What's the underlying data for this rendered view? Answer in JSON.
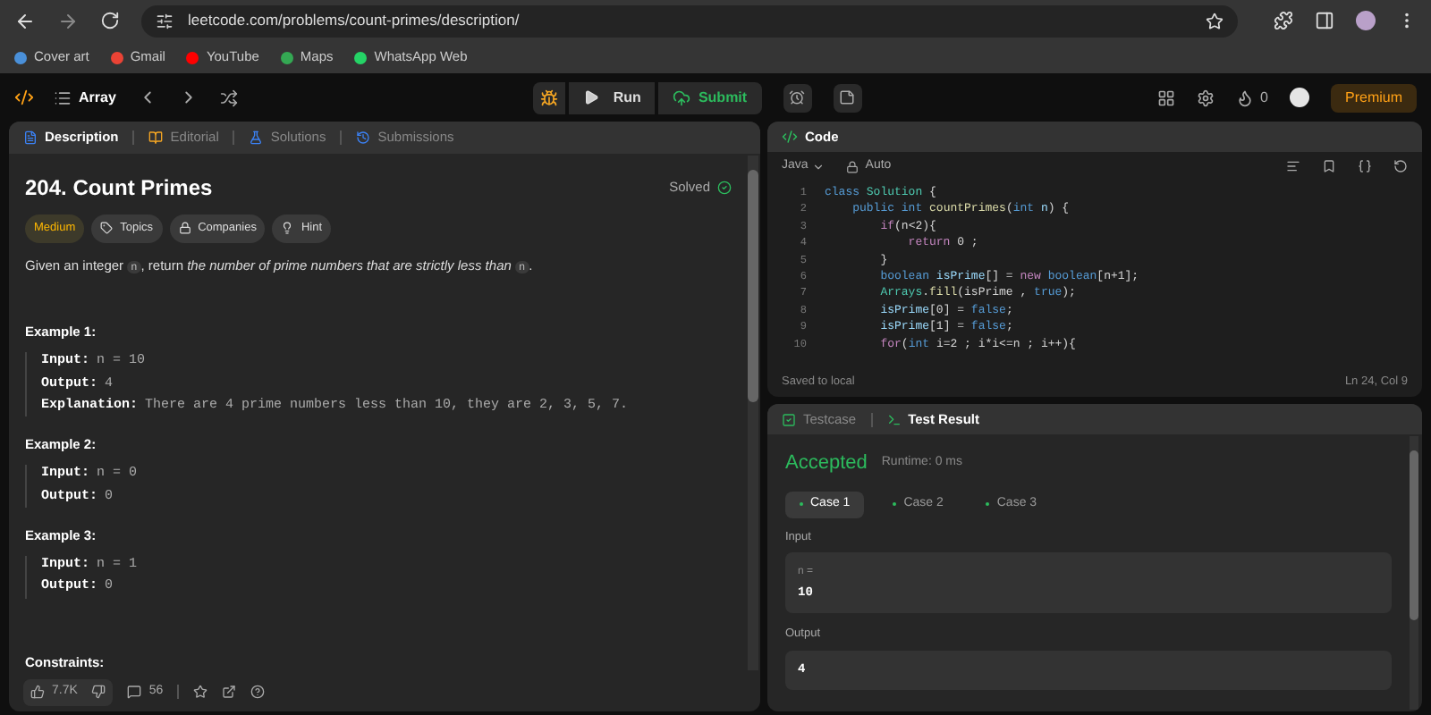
{
  "browser": {
    "url": "leetcode.com/problems/count-primes/description/",
    "bookmarks": [
      {
        "label": "Cover art",
        "color": "#4a90d9"
      },
      {
        "label": "Gmail",
        "color": "#ea4335"
      },
      {
        "label": "YouTube",
        "color": "#ff0000"
      },
      {
        "label": "Maps",
        "color": "#34a853"
      },
      {
        "label": "WhatsApp Web",
        "color": "#25d366"
      }
    ]
  },
  "nav": {
    "list_title": "Array",
    "run": "Run",
    "submit": "Submit",
    "streak": "0",
    "premium": "Premium"
  },
  "problem_tabs": [
    {
      "label": "Description",
      "selected": true
    },
    {
      "label": "Editorial",
      "selected": false
    },
    {
      "label": "Solutions",
      "selected": false
    },
    {
      "label": "Submissions",
      "selected": false
    }
  ],
  "problem": {
    "title": "204. Count Primes",
    "status": "Solved",
    "difficulty": "Medium",
    "tags": [
      "Topics",
      "Companies",
      "Hint"
    ],
    "description": [
      {
        "text": "Given an integer ",
        "kind": "plain"
      },
      {
        "text": "n",
        "kind": "code"
      },
      {
        "text": ", return ",
        "kind": "plain"
      },
      {
        "text": "the number of prime numbers that are strictly less than ",
        "kind": "italic"
      },
      {
        "text": "n",
        "kind": "code"
      },
      {
        "text": ".",
        "kind": "plain"
      }
    ],
    "examples": [
      {
        "title": "Example 1:",
        "lines": [
          {
            "label": "Input:",
            "value": "n = 10"
          },
          {
            "label": "Output:",
            "value": "4"
          },
          {
            "label": "Explanation:",
            "value": "There are 4 prime numbers less than 10, they are 2, 3, 5, 7."
          }
        ]
      },
      {
        "title": "Example 2:",
        "lines": [
          {
            "label": "Input:",
            "value": "n = 0"
          },
          {
            "label": "Output:",
            "value": "0"
          }
        ]
      },
      {
        "title": "Example 3:",
        "lines": [
          {
            "label": "Input:",
            "value": "n = 1"
          },
          {
            "label": "Output:",
            "value": "0"
          }
        ]
      }
    ],
    "constraints_title": "Constraints:"
  },
  "footer": {
    "likes": "7.7K",
    "comments": "56"
  },
  "code_panel": {
    "title": "Code",
    "language": "Java",
    "mode": "Auto",
    "status": "Saved to local",
    "cursor": "Ln 24, Col 9",
    "lines": [
      {
        "number": "1",
        "tokens": [
          {
            "text": "class ",
            "kind": "kw"
          },
          {
            "text": "Solution",
            "kind": "type"
          },
          {
            "text": " {",
            "kind": "p"
          }
        ]
      },
      {
        "number": "2",
        "tokens": [
          {
            "text": "    public int ",
            "kind": "kw"
          },
          {
            "text": "countPrimes",
            "kind": "fn"
          },
          {
            "text": "(",
            "kind": "p"
          },
          {
            "text": "int ",
            "kind": "kw"
          },
          {
            "text": "n",
            "kind": "var"
          },
          {
            "text": ") {",
            "kind": "p"
          }
        ]
      },
      {
        "number": "3",
        "tokens": [
          {
            "text": "        if",
            "kind": "ctl"
          },
          {
            "text": "(n<2){",
            "kind": "p"
          }
        ]
      },
      {
        "number": "4",
        "tokens": [
          {
            "text": "            return ",
            "kind": "ctl"
          },
          {
            "text": "0 ;",
            "kind": "p"
          }
        ]
      },
      {
        "number": "5",
        "tokens": [
          {
            "text": "        }",
            "kind": "p"
          }
        ]
      },
      {
        "number": "6",
        "tokens": [
          {
            "text": "        boolean ",
            "kind": "kw"
          },
          {
            "text": "isPrime",
            "kind": "var"
          },
          {
            "text": "[] = ",
            "kind": "p"
          },
          {
            "text": "new ",
            "kind": "ctl"
          },
          {
            "text": "boolean",
            "kind": "kw"
          },
          {
            "text": "[n+1];",
            "kind": "p"
          }
        ]
      },
      {
        "number": "7",
        "tokens": [
          {
            "text": "        Arrays",
            "kind": "type"
          },
          {
            "text": ".",
            "kind": "p"
          },
          {
            "text": "fill",
            "kind": "fn"
          },
          {
            "text": "(isPrime , ",
            "kind": "p"
          },
          {
            "text": "true",
            "kind": "kw"
          },
          {
            "text": ");",
            "kind": "p"
          }
        ]
      },
      {
        "number": "8",
        "tokens": [
          {
            "text": "        isPrime",
            "kind": "var"
          },
          {
            "text": "[0] = ",
            "kind": "p"
          },
          {
            "text": "false",
            "kind": "kw"
          },
          {
            "text": ";",
            "kind": "p"
          }
        ]
      },
      {
        "number": "9",
        "tokens": [
          {
            "text": "        isPrime",
            "kind": "var"
          },
          {
            "text": "[1] = ",
            "kind": "p"
          },
          {
            "text": "false",
            "kind": "kw"
          },
          {
            "text": ";",
            "kind": "p"
          }
        ]
      },
      {
        "number": "10",
        "tokens": [
          {
            "text": "        for",
            "kind": "ctl"
          },
          {
            "text": "(",
            "kind": "p"
          },
          {
            "text": "int ",
            "kind": "kw"
          },
          {
            "text": "i=2 ; i*i<=n ; i++){",
            "kind": "p"
          }
        ]
      }
    ]
  },
  "result_tabs": [
    {
      "label": "Testcase",
      "selected": false
    },
    {
      "label": "Test Result",
      "selected": true
    }
  ],
  "result": {
    "verdict": "Accepted",
    "runtime": "Runtime: 0 ms",
    "cases": [
      {
        "label": "Case 1",
        "selected": true
      },
      {
        "label": "Case 2",
        "selected": false
      },
      {
        "label": "Case 3",
        "selected": false
      }
    ],
    "input_label": "Input",
    "input_name": "n =",
    "input_value": "10",
    "output_label": "Output",
    "output_value": "4"
  }
}
